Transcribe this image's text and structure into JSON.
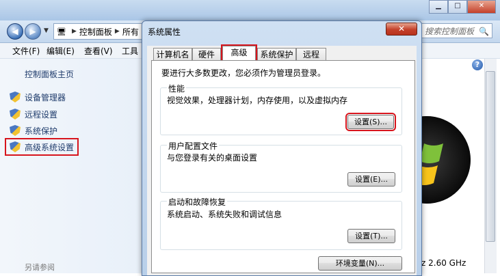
{
  "explorer": {
    "breadcrumb": [
      "控制面板",
      "所有"
    ],
    "search_placeholder": "搜索控制面板",
    "menu": [
      "文件(F)",
      "编辑(E)",
      "查看(V)",
      "工具"
    ],
    "left_pane": {
      "home": "控制面板主页",
      "items": [
        "设备管理器",
        "远程设置",
        "系统保护",
        "高级系统设置"
      ],
      "see_also": "另请参阅"
    },
    "cpu_text": "z  2.60 GHz"
  },
  "dialog": {
    "title": "系统属性",
    "close": "✕",
    "tabs": [
      "计算机名",
      "硬件",
      "高级",
      "系统保护",
      "远程"
    ],
    "active_tab": "高级",
    "admin_note": "要进行大多数更改，您必须作为管理员登录。",
    "groups": [
      {
        "label": "性能",
        "desc": "视觉效果，处理器计划，内存使用，以及虚拟内存",
        "button": "设置(S)..."
      },
      {
        "label": "用户配置文件",
        "desc": "与您登录有关的桌面设置",
        "button": "设置(E)..."
      },
      {
        "label": "启动和故障恢复",
        "desc": "系统启动、系统失败和调试信息",
        "button": "设置(T)..."
      }
    ],
    "env_button": "环境变量(N)..."
  },
  "colors": {
    "highlight": "#d7141c",
    "link": "#1e3b6b"
  }
}
